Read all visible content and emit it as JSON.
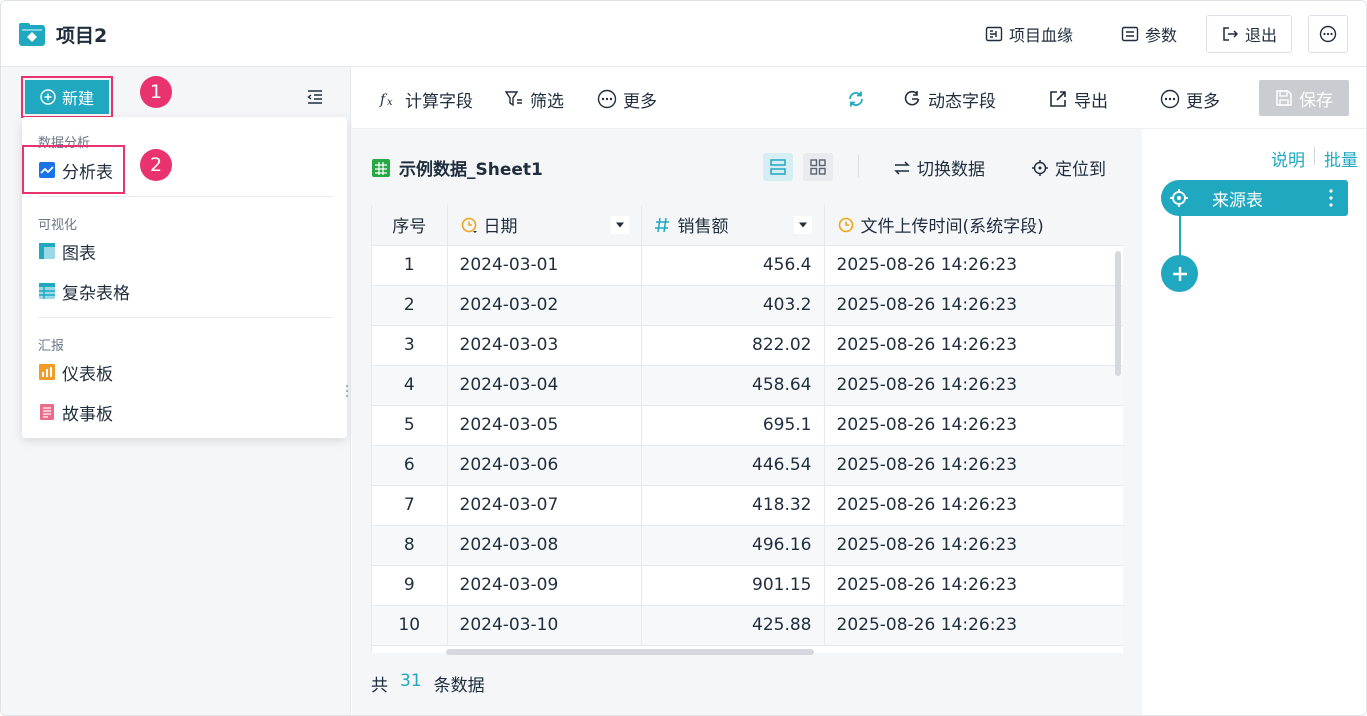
{
  "header": {
    "project_title": "项目2",
    "lineage_label": "项目血缘",
    "params_label": "参数",
    "exit_label": "退出"
  },
  "left_panel": {
    "new_label": "新建",
    "step1": "1",
    "step2": "2",
    "menu": {
      "section_analysis": "数据分析",
      "item_analysis_table": "分析表",
      "section_visual": "可视化",
      "item_chart": "图表",
      "item_complex_table": "复杂表格",
      "section_report": "汇报",
      "item_dashboard": "仪表板",
      "item_storyboard": "故事板"
    }
  },
  "toolbar": {
    "calc_field": "计算字段",
    "filter": "筛选",
    "more_left": "更多",
    "dynamic_field": "动态字段",
    "export": "导出",
    "more_right": "更多",
    "save": "保存"
  },
  "main": {
    "table_name": "示例数据_Sheet1",
    "switch_data": "切换数据",
    "locate_to": "定位到",
    "columns": [
      "序号",
      "日期",
      "销售额",
      "文件上传时间(系统字段)"
    ],
    "rows": [
      [
        "1",
        "2024-03-01",
        "456.4",
        "2025-08-26 14:26:23"
      ],
      [
        "2",
        "2024-03-02",
        "403.2",
        "2025-08-26 14:26:23"
      ],
      [
        "3",
        "2024-03-03",
        "822.02",
        "2025-08-26 14:26:23"
      ],
      [
        "4",
        "2024-03-04",
        "458.64",
        "2025-08-26 14:26:23"
      ],
      [
        "5",
        "2024-03-05",
        "695.1",
        "2025-08-26 14:26:23"
      ],
      [
        "6",
        "2024-03-06",
        "446.54",
        "2025-08-26 14:26:23"
      ],
      [
        "7",
        "2024-03-07",
        "418.32",
        "2025-08-26 14:26:23"
      ],
      [
        "8",
        "2024-03-08",
        "496.16",
        "2025-08-26 14:26:23"
      ],
      [
        "9",
        "2024-03-09",
        "901.15",
        "2025-08-26 14:26:23"
      ],
      [
        "10",
        "2024-03-10",
        "425.88",
        "2025-08-26 14:26:23"
      ]
    ],
    "footer_prefix": "共",
    "footer_count": "31",
    "footer_suffix": "条数据"
  },
  "right_panel": {
    "explain": "说明",
    "batch": "批量",
    "source_node": "来源表"
  },
  "colors": {
    "accent": "#1fa8c0",
    "highlight": "#e8336f",
    "save_disabled": "#c9ccd1"
  }
}
